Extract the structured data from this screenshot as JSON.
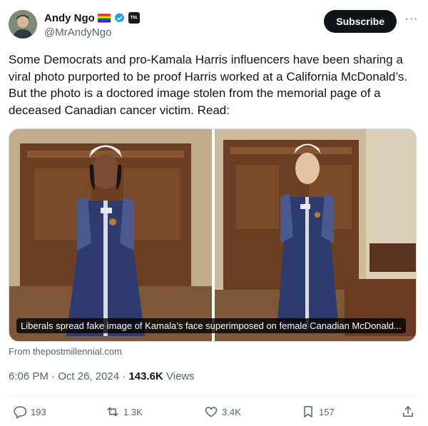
{
  "author": {
    "name": "Andy Ngo",
    "handle": "@MrAndyNgo",
    "affiliate_badge": "TSL"
  },
  "header": {
    "subscribe_label": "Subscribe",
    "more_label": "···"
  },
  "tweet": {
    "text": "Some Democrats and pro-Kamala Harris influencers have been sharing a viral photo purported to be proof Harris worked at a California McDonald’s. But the photo is a doctored image stolen from the memorial page of a deceased Canadian cancer victim. Read:",
    "media_caption": "Liberals spread fake image of Kamala’s face superimposed on female Canadian McDonald...",
    "link_source": "From thepostmillennial.com"
  },
  "meta": {
    "time": "6:06 PM",
    "date": "Oct 26, 2024",
    "views_count": "143.6K",
    "views_label": "Views"
  },
  "actions": {
    "replies": "193",
    "reposts": "1.3K",
    "likes": "3.4K",
    "bookmarks": "157"
  },
  "colors": {
    "text_primary": "#0f1419",
    "text_secondary": "#536471",
    "verified_blue": "#1d9bf0",
    "button_dark": "#0f1419"
  }
}
